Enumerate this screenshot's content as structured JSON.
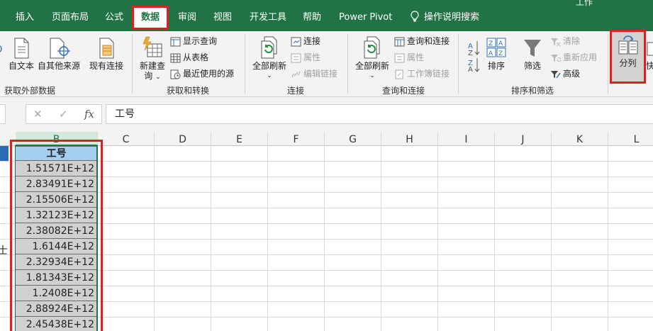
{
  "window": {
    "title_fragment": "工作"
  },
  "tabs": [
    {
      "label": "插入",
      "active": false
    },
    {
      "label": "页面布局",
      "active": false
    },
    {
      "label": "公式",
      "active": false
    },
    {
      "label": "数据",
      "active": true
    },
    {
      "label": "审阅",
      "active": false
    },
    {
      "label": "视图",
      "active": false
    },
    {
      "label": "开发工具",
      "active": false
    },
    {
      "label": "帮助",
      "active": false
    },
    {
      "label": "Power Pivot",
      "active": false
    },
    {
      "label": "操作说明搜索",
      "active": false,
      "icon": "lightbulb-icon"
    }
  ],
  "ribbon": {
    "groups": {
      "get_external": {
        "label": "获取外部数据",
        "buttons": {
          "from_text": "自文本",
          "from_other": "自其他来源",
          "existing": "现有连接"
        }
      },
      "get_transform": {
        "label": "获取和转换",
        "new_query_line1": "新建查",
        "new_query_line2": "询",
        "show_query": "显示查询",
        "from_table": "从表格",
        "recent_sources": "最近使用的源"
      },
      "connections": {
        "label": "连接",
        "refresh_all": "全部刷新",
        "connections": "连接",
        "properties": "属性",
        "edit_links": "编辑链接"
      },
      "queries": {
        "label": "查询和连接",
        "refresh_all": "全部刷新",
        "queries_connections": "查询和连接",
        "properties": "属性",
        "workbook_links": "工作簿链接"
      },
      "sort_filter": {
        "label": "排序和筛选",
        "sort": "排序",
        "filter": "筛选",
        "clear": "清除",
        "reapply": "重新应用",
        "advanced": "高级",
        "sort_az": "A Z",
        "sort_za": "Z A"
      },
      "data_tools": {
        "split_columns": "分列",
        "quick_fill_fragment": "快"
      }
    }
  },
  "formula_bar": {
    "cancel": "✕",
    "enter": "✓",
    "fx": "fx",
    "value": "工号"
  },
  "columns": [
    "B",
    "C",
    "D",
    "E",
    "F",
    "G",
    "H",
    "I",
    "J",
    "K",
    "L"
  ],
  "selected_column": "B",
  "sheet": {
    "header": "工号",
    "values": [
      "1.51571E+12",
      "2.83491E+12",
      "2.15506E+12",
      "1.32123E+12",
      "2.38082E+12",
      "1.6144E+12",
      "2.32934E+12",
      "1.81343E+12",
      "1.2408E+12",
      "2.88924E+12",
      "2.45438E+12"
    ],
    "left_fragment": "士"
  },
  "colors": {
    "excel_green": "#217346",
    "highlight_red": "#e02020",
    "header_fill": "#a6cfef",
    "cell_fill": "#d0d0d0"
  }
}
